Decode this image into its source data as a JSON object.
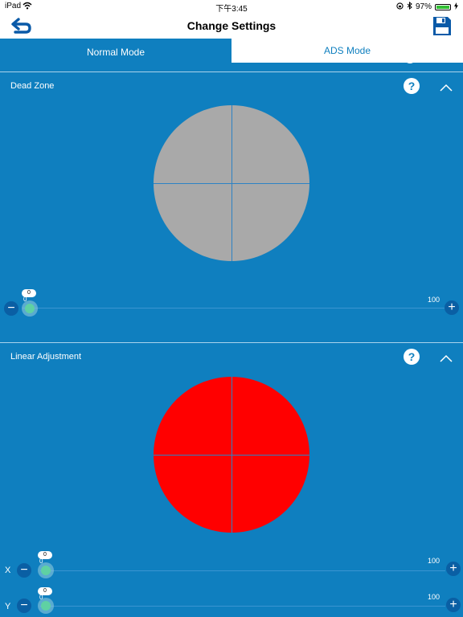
{
  "status_bar": {
    "device": "iPad",
    "time": "下午3:45",
    "battery": "97%",
    "battery_level": 0.97
  },
  "nav": {
    "title": "Change Settings",
    "back_icon": "back-arrow-icon",
    "save_icon": "floppy-disk-icon"
  },
  "tabs": [
    {
      "label": "Normal Mode",
      "active": true
    },
    {
      "label": "ADS Mode",
      "active": false
    }
  ],
  "sections": {
    "dead_zone": {
      "title": "Dead Zone",
      "circle_color": "#a9a9a9",
      "slider": {
        "value": "0",
        "min_label": "0",
        "max_label": "100"
      }
    },
    "linear_adjustment": {
      "title": "Linear Adjustment",
      "circle_color": "#ff0000",
      "sliders": [
        {
          "axis": "X",
          "value": "0",
          "min_label": "0",
          "max_label": "100"
        },
        {
          "axis": "Y",
          "value": "0",
          "min_label": "0",
          "max_label": "100"
        }
      ]
    }
  },
  "colors": {
    "background": "#0f7fbf",
    "accent": "#0f7fbf",
    "knob": "#5fd1a3"
  }
}
